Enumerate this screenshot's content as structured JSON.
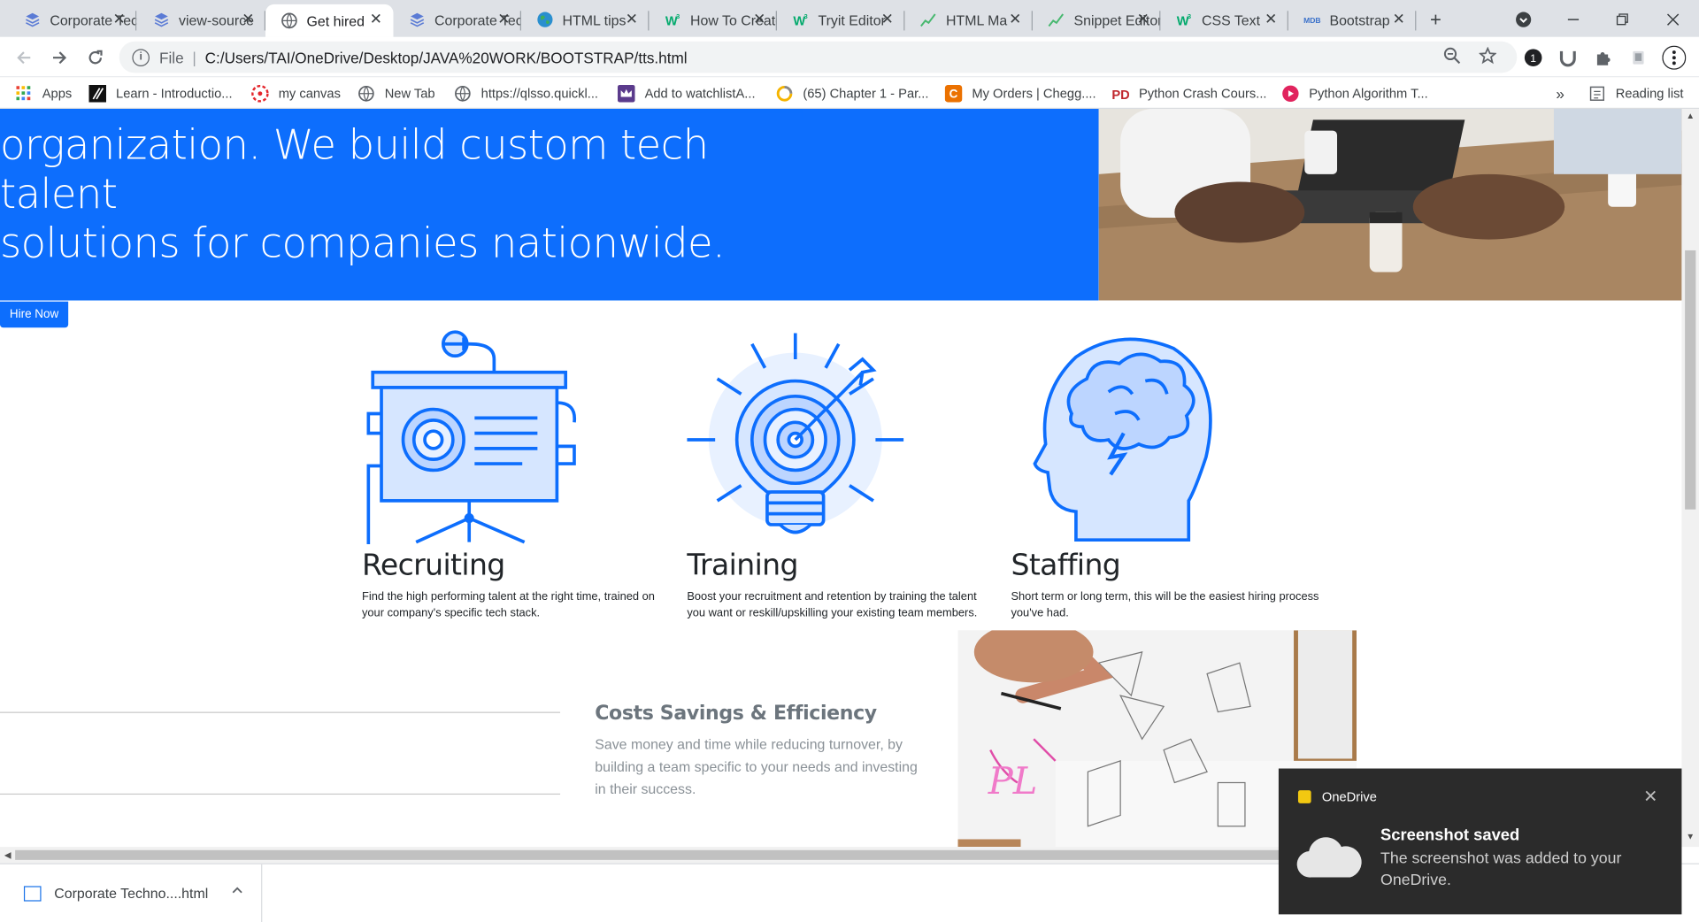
{
  "browser": {
    "tabs": [
      {
        "label": "Corporate Techno",
        "icon": "stack-icon",
        "active": false
      },
      {
        "label": "view-source",
        "icon": "stack-icon",
        "active": false
      },
      {
        "label": "Get hired",
        "icon": "globe-icon",
        "active": true
      },
      {
        "label": "Corporate Techno",
        "icon": "stack-icon",
        "active": false
      },
      {
        "label": "HTML tips",
        "icon": "earth-icon",
        "active": false
      },
      {
        "label": "How To Create",
        "icon": "w3schools-icon",
        "active": false
      },
      {
        "label": "Tryit Editor",
        "icon": "w3schools-icon",
        "active": false
      },
      {
        "label": "HTML Ma",
        "icon": "chart-icon",
        "active": false
      },
      {
        "label": "Snippet Editor",
        "icon": "chart-icon",
        "active": false
      },
      {
        "label": "CSS Text",
        "icon": "w3schools-icon",
        "active": false
      },
      {
        "label": "Bootstrap",
        "icon": "mdb-icon",
        "active": false
      }
    ],
    "new_tab_symbol": "+",
    "address": {
      "scheme_label": "File",
      "url": "C:/Users/TAI/OneDrive/Desktop/JAVA%20WORK/BOOTSTRAP/tts.html"
    },
    "extension_badge": "1",
    "bookmarks": [
      {
        "label": "Apps",
        "icon": "apps-grid-icon"
      },
      {
        "label": "Learn - Introductio...",
        "icon": "learn-icon"
      },
      {
        "label": "my canvas",
        "icon": "canvas-icon"
      },
      {
        "label": "New Tab",
        "icon": "globe-icon"
      },
      {
        "label": "https://qlsso.quickl...",
        "icon": "globe-icon"
      },
      {
        "label": "Add to watchlistA...",
        "icon": "crown-icon"
      },
      {
        "label": "(65) Chapter 1 - Par...",
        "icon": "spinner-icon"
      },
      {
        "label": "My Orders | Chegg....",
        "icon": "chegg-icon"
      },
      {
        "label": "Python Crash Cours...",
        "icon": "pd-icon"
      },
      {
        "label": "Python Algorithm T...",
        "icon": "play-icon"
      }
    ],
    "bookmarks_overflow": "»",
    "reading_list": "Reading list"
  },
  "page": {
    "hero_text_line1": "organization. We build custom tech talent",
    "hero_text_line2": "solutions for companies nationwide.",
    "hire_button": "Hire Now",
    "services": [
      {
        "title": "Recruiting",
        "text": "Find the high performing talent at the right time, trained on your company's specific tech stack."
      },
      {
        "title": "Training",
        "text": "Boost your recruitment and retention by training the talent you want or reskill/upskilling your existing team members."
      },
      {
        "title": "Staffing",
        "text": "Short term or long term, this will be the easiest hiring process you've had."
      }
    ],
    "cost_title": "Costs Savings & Efficiency",
    "cost_text": "Save money and time while reducing turnover, by building a team specific to your needs and investing in their success."
  },
  "download": {
    "filename": "Corporate Techno....html"
  },
  "toast": {
    "app": "OneDrive",
    "title": "Screenshot saved",
    "message": "The screenshot was added to your OneDrive."
  },
  "colors": {
    "accent": "#0d6efd",
    "icon_fill": "#d6e6ff",
    "icon_stroke": "#0d6efd"
  }
}
